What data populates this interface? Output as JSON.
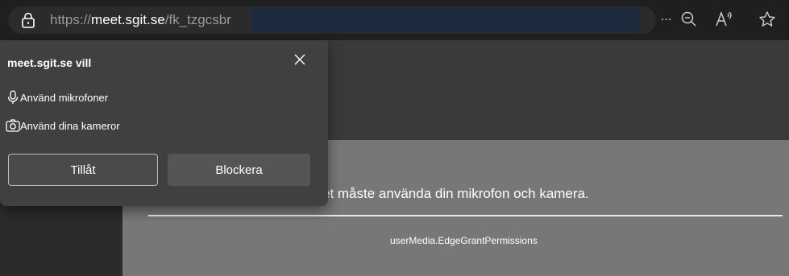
{
  "browser": {
    "url_scheme": "https://",
    "url_host": "meet.sgit.se",
    "url_path": "/fk_tzgcsbr",
    "more_label": "..."
  },
  "popup": {
    "title": "meet.sgit.se vill",
    "permissions": [
      {
        "label": "Använd mikrofoner",
        "icon": "microphone-icon"
      },
      {
        "label": "Använd dina kameror",
        "icon": "camera-icon"
      }
    ],
    "allow_label": "Tillåt",
    "block_label": "Blockera"
  },
  "page": {
    "message": "et måste använda din mikrofon och kamera.",
    "code": "userMedia.EdgeGrantPermissions"
  },
  "colors": {
    "gray_panel": "#777777",
    "popup_bg": "#404040"
  }
}
